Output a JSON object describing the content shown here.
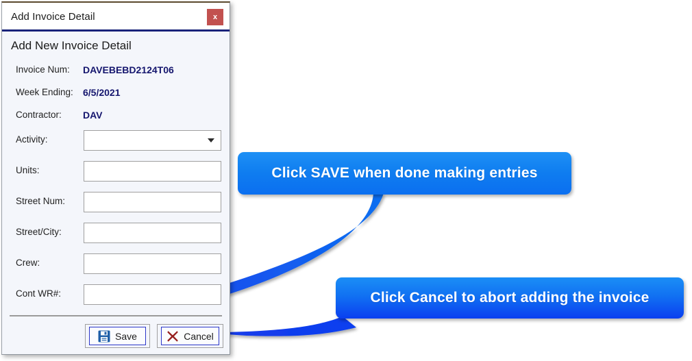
{
  "window": {
    "title": "Add Invoice Detail",
    "close_label": "x",
    "close_icon": "close-icon",
    "accent_border": "#18227a",
    "close_bg": "#c2514f"
  },
  "dialog": {
    "heading": "Add New Invoice Detail",
    "info_rows": [
      {
        "label": "Invoice Num:",
        "value": "DAVEBEBD2124T06"
      },
      {
        "label": "Week Ending:",
        "value": "6/5/2021"
      },
      {
        "label": "Contractor:",
        "value": "DAV"
      }
    ],
    "value_color": "#15166e",
    "fields": [
      {
        "label": "Activity:",
        "type": "select",
        "value": "",
        "placeholder": "",
        "icon": "chevron-down-icon"
      },
      {
        "label": "Units:",
        "type": "text",
        "value": "",
        "placeholder": ""
      },
      {
        "label": "Street Num:",
        "type": "text",
        "value": "",
        "placeholder": ""
      },
      {
        "label": "Street/City:",
        "type": "text",
        "value": "",
        "placeholder": ""
      },
      {
        "label": "Crew:",
        "type": "text",
        "value": "",
        "placeholder": ""
      },
      {
        "label": "Cont WR#:",
        "type": "text",
        "value": "",
        "placeholder": ""
      }
    ],
    "buttons": {
      "save": {
        "label": "Save",
        "icon": "save-floppy-icon",
        "icon_color": "#1f5fa8"
      },
      "cancel": {
        "label": "Cancel",
        "icon": "close-cross-icon",
        "icon_color": "#96201f"
      }
    }
  },
  "callouts": [
    {
      "id": "callout-save",
      "text": "Click SAVE when done making entries",
      "color_top": "#1e90f5",
      "color_bottom": "#0b6ff0",
      "points_to": "save-button"
    },
    {
      "id": "callout-cancel",
      "text": "Click Cancel to abort adding the invoice",
      "color_top": "#1b8ef6",
      "color_bottom": "#0a3ff0",
      "points_to": "cancel-button"
    }
  ]
}
